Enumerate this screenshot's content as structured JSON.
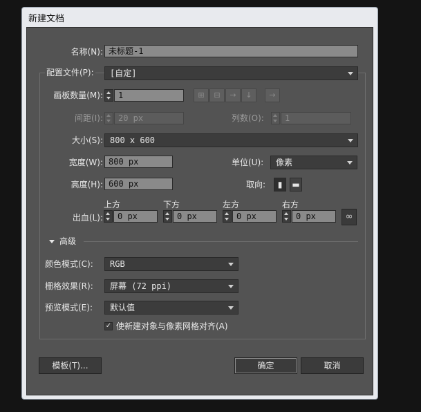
{
  "window": {
    "title": "新建文档"
  },
  "name": {
    "label": "名称(N):",
    "value": "未标题-1"
  },
  "profile": {
    "label": "配置文件(P):",
    "value": "[自定]"
  },
  "artboards": {
    "count_label": "画板数量(M):",
    "count_value": "1",
    "spacing_label": "间距(I):",
    "spacing_value": "20 px",
    "columns_label": "列数(O):",
    "columns_value": "1",
    "arrange_icons": [
      "grid-by-row-icon",
      "grid-by-column-icon",
      "arrange-by-row-icon",
      "arrange-by-column-icon",
      "right-to-left-icon"
    ]
  },
  "size": {
    "label": "大小(S):",
    "value": "800 x 600"
  },
  "width": {
    "label": "宽度(W):",
    "value": "800 px"
  },
  "height": {
    "label": "高度(H):",
    "value": "600 px"
  },
  "units": {
    "label": "单位(U):",
    "value": "像素"
  },
  "orientation": {
    "label": "取向:",
    "options": [
      "portrait",
      "landscape"
    ]
  },
  "bleed": {
    "label": "出血(L):",
    "top_label": "上方",
    "bottom_label": "下方",
    "left_label": "左方",
    "right_label": "右方",
    "top": "0 px",
    "bottom": "0 px",
    "left": "0 px",
    "right": "0 px"
  },
  "advanced": {
    "label": "高级",
    "color_mode_label": "颜色模式(C):",
    "color_mode": "RGB",
    "raster_label": "栅格效果(R):",
    "raster": "屏幕 (72 ppi)",
    "preview_label": "预览模式(E):",
    "preview": "默认值",
    "align_label": "使新建对象与像素网格对齐(A)",
    "align_checked": true
  },
  "buttons": {
    "templates": "模板(T)...",
    "ok": "确定",
    "cancel": "取消"
  },
  "colors": {
    "panel": "#535353",
    "field": "#8a8a8a",
    "dark_control": "#3c3c3c",
    "text": "#e6e6e6"
  }
}
